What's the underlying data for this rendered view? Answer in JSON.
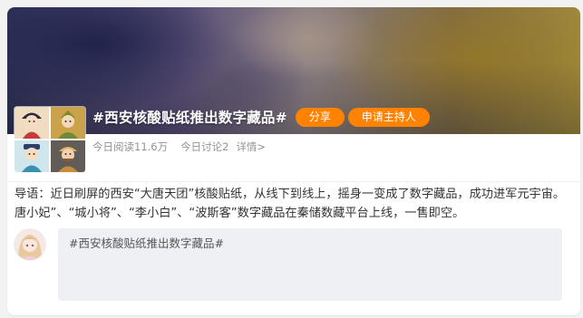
{
  "topic": {
    "title": "#西安核酸贴纸推出数字藏品#",
    "share_label": "分享",
    "host_label": "申请主持人",
    "reads": "今日阅读11.6万",
    "discussions": "今日讨论2",
    "details": "详情>"
  },
  "intro": {
    "text": "导语：近日刷屏的西安“大唐天团”核酸贴纸，从线下到线上，摇身一变成了数字藏品，成功进军元宇宙。唐小妃”、“城小将”、“李小白”、“波斯客”数字藏品在秦储数藏平台上线，一售即空。"
  },
  "comment": {
    "value": "#西安核酸贴纸推出数字藏品#"
  },
  "colors": {
    "accent": "#ff8200",
    "text": "#333333",
    "muted": "#939393",
    "input_bg": "#eff0f3"
  },
  "icons": {
    "thumbnail": "tang-characters-thumbnail",
    "avatar": "user-avatar"
  }
}
